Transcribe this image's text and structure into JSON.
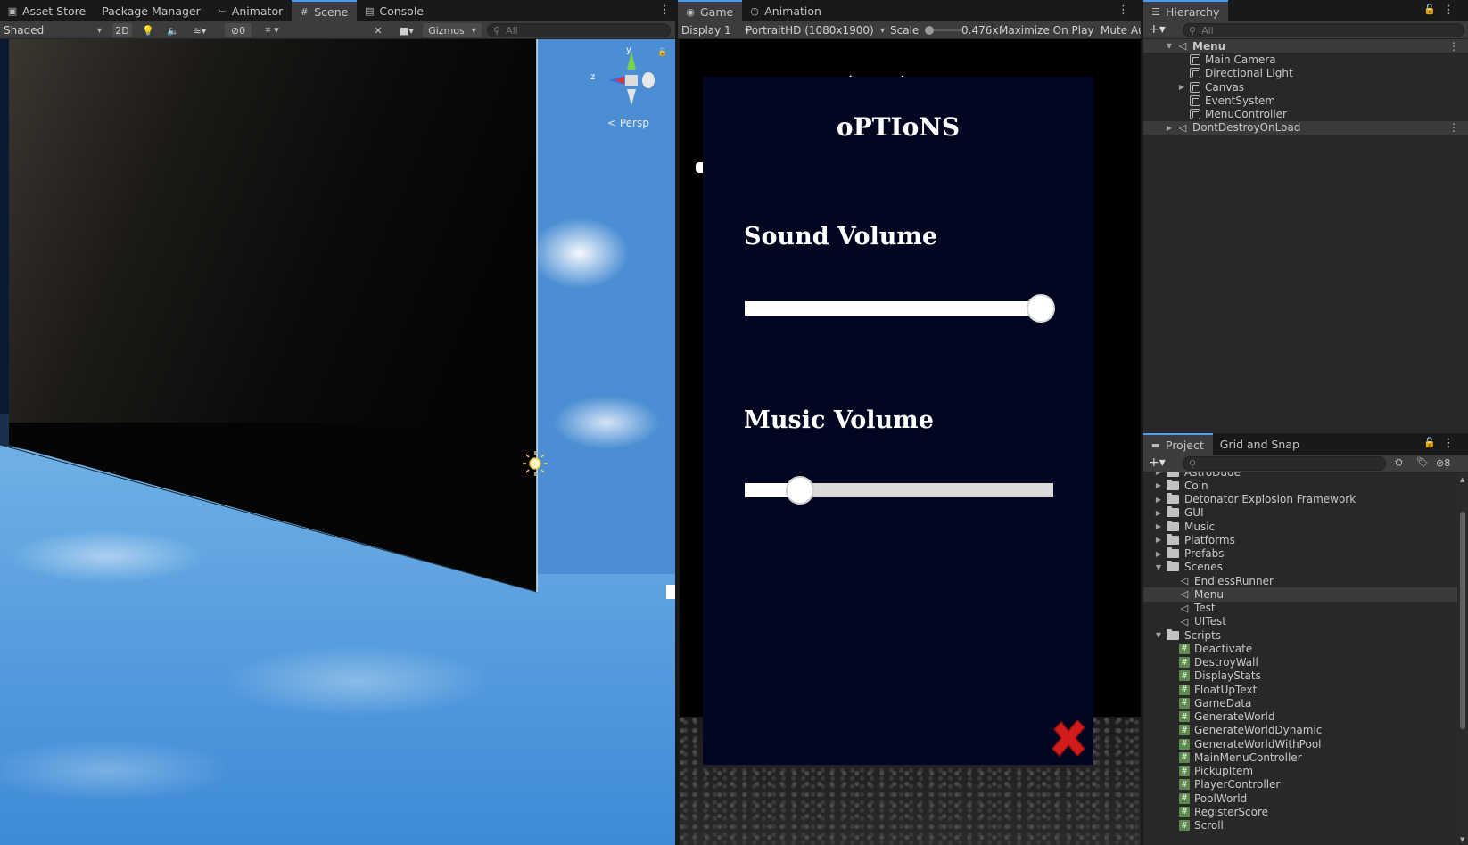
{
  "scene_panel": {
    "tabs": [
      {
        "label": "Asset Store",
        "icon": "bag-icon"
      },
      {
        "label": "Package Manager",
        "icon": ""
      },
      {
        "label": "Animator",
        "icon": "animator-icon"
      },
      {
        "label": "Scene",
        "icon": "grid-icon"
      },
      {
        "label": "Console",
        "icon": "console-icon"
      }
    ],
    "active_tab": "Scene",
    "shading_mode": "Shaded",
    "mode_2d": "2D",
    "hidden_count": "0",
    "gizmos": "Gizmos",
    "search_placeholder": "All",
    "gizmo_axes": {
      "y": "y",
      "z": "z"
    },
    "projection": "< Persp"
  },
  "game_panel": {
    "tabs": [
      {
        "label": "Game",
        "icon": "gamepad-icon"
      },
      {
        "label": "Animation",
        "icon": "animation-icon"
      }
    ],
    "active_tab": "Game",
    "display": "Display 1",
    "resolution": "PortraitHD (1080x1900)",
    "scale_label": "Scale",
    "scale_value": "0.476x",
    "scale_fraction": 0.05,
    "maximize": "Maximize On Play",
    "mute": "Mute Au",
    "options_menu": {
      "title": "oPTIoNS",
      "sound_label": "Sound Volume",
      "sound_value": 0.96,
      "music_label": "Music Volume",
      "music_value": 0.18,
      "close_icon": "red-x-icon"
    }
  },
  "hierarchy": {
    "tab": "Hierarchy",
    "search_placeholder": "All",
    "items": [
      {
        "label": "Menu",
        "depth": 0,
        "type": "scene",
        "expanded": true,
        "selected": true
      },
      {
        "label": "Main Camera",
        "depth": 1,
        "type": "go"
      },
      {
        "label": "Directional Light",
        "depth": 1,
        "type": "go"
      },
      {
        "label": "Canvas",
        "depth": 1,
        "type": "go",
        "foldable": true
      },
      {
        "label": "EventSystem",
        "depth": 1,
        "type": "go"
      },
      {
        "label": "MenuController",
        "depth": 1,
        "type": "go"
      },
      {
        "label": "DontDestroyOnLoad",
        "depth": 0,
        "type": "scene",
        "foldable": true,
        "selected": true
      }
    ]
  },
  "project": {
    "tabs": [
      "Project",
      "Grid and Snap"
    ],
    "active_tab": "Project",
    "hidden_count": "8",
    "items": [
      {
        "label": "AstroDude",
        "depth": 0,
        "type": "folder"
      },
      {
        "label": "Coin",
        "depth": 0,
        "type": "folder"
      },
      {
        "label": "Detonator Explosion Framework",
        "depth": 0,
        "type": "folder"
      },
      {
        "label": "GUI",
        "depth": 0,
        "type": "folder"
      },
      {
        "label": "Music",
        "depth": 0,
        "type": "folder"
      },
      {
        "label": "Platforms",
        "depth": 0,
        "type": "folder"
      },
      {
        "label": "Prefabs",
        "depth": 0,
        "type": "folder"
      },
      {
        "label": "Scenes",
        "depth": 0,
        "type": "folder-open"
      },
      {
        "label": "EndlessRunner",
        "depth": 1,
        "type": "scene"
      },
      {
        "label": "Menu",
        "depth": 1,
        "type": "scene",
        "selected": true
      },
      {
        "label": "Test",
        "depth": 1,
        "type": "scene"
      },
      {
        "label": "UITest",
        "depth": 1,
        "type": "scene"
      },
      {
        "label": "Scripts",
        "depth": 0,
        "type": "folder-open"
      },
      {
        "label": "Deactivate",
        "depth": 1,
        "type": "script"
      },
      {
        "label": "DestroyWall",
        "depth": 1,
        "type": "script"
      },
      {
        "label": "DisplayStats",
        "depth": 1,
        "type": "script"
      },
      {
        "label": "FloatUpText",
        "depth": 1,
        "type": "script"
      },
      {
        "label": "GameData",
        "depth": 1,
        "type": "script"
      },
      {
        "label": "GenerateWorld",
        "depth": 1,
        "type": "script"
      },
      {
        "label": "GenerateWorldDynamic",
        "depth": 1,
        "type": "script"
      },
      {
        "label": "GenerateWorldWithPool",
        "depth": 1,
        "type": "script"
      },
      {
        "label": "MainMenuController",
        "depth": 1,
        "type": "script"
      },
      {
        "label": "PickupItem",
        "depth": 1,
        "type": "script"
      },
      {
        "label": "PlayerController",
        "depth": 1,
        "type": "script"
      },
      {
        "label": "PoolWorld",
        "depth": 1,
        "type": "script"
      },
      {
        "label": "RegisterScore",
        "depth": 1,
        "type": "script"
      },
      {
        "label": "Scroll",
        "depth": 1,
        "type": "script"
      }
    ]
  },
  "colors": {
    "accent": "#4c9bf0",
    "panel_bg": "#282828",
    "toolbar_bg": "#3c3c3c",
    "menu_bg": "#030621",
    "close_red": "#d21c1c"
  }
}
